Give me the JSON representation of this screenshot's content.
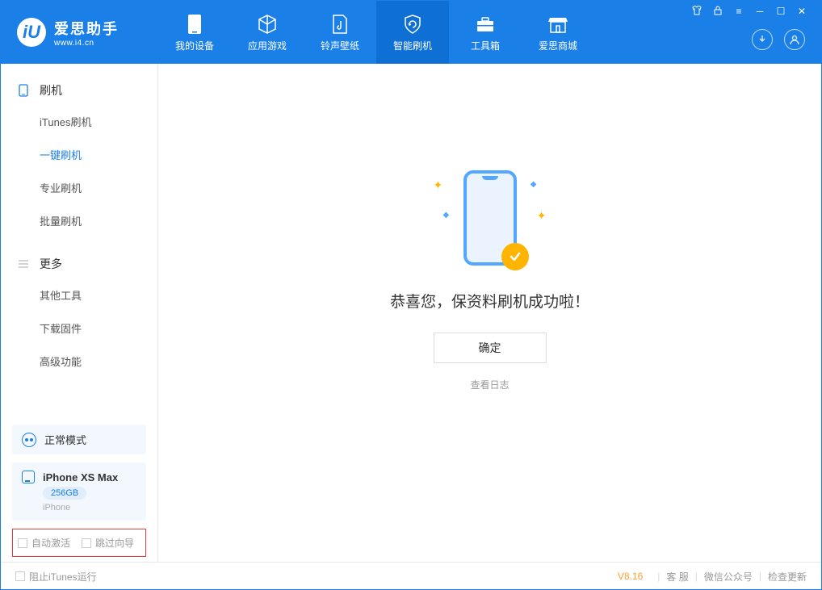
{
  "app": {
    "name": "爱思助手",
    "url": "www.i4.cn"
  },
  "nav": [
    {
      "label": "我的设备"
    },
    {
      "label": "应用游戏"
    },
    {
      "label": "铃声壁纸"
    },
    {
      "label": "智能刷机"
    },
    {
      "label": "工具箱"
    },
    {
      "label": "爱思商城"
    }
  ],
  "sidebar": {
    "section1": {
      "title": "刷机",
      "items": [
        "iTunes刷机",
        "一键刷机",
        "专业刷机",
        "批量刷机"
      ]
    },
    "section2": {
      "title": "更多",
      "items": [
        "其他工具",
        "下载固件",
        "高级功能"
      ]
    }
  },
  "mode": {
    "label": "正常模式"
  },
  "device": {
    "name": "iPhone XS Max",
    "capacity": "256GB",
    "type": "iPhone"
  },
  "options": {
    "auto_activate": "自动激活",
    "skip_guide": "跳过向导"
  },
  "main": {
    "success_msg": "恭喜您，保资料刷机成功啦！",
    "ok": "确定",
    "view_log": "查看日志"
  },
  "footer": {
    "block_itunes": "阻止iTunes运行",
    "version": "V8.16",
    "support": "客 服",
    "wechat": "微信公众号",
    "update": "检查更新"
  }
}
